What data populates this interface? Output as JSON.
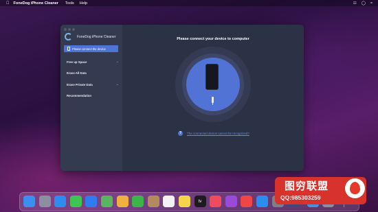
{
  "menubar": {
    "app_name": "FoneDog iPhone Cleaner",
    "items": [
      "Tools",
      "Help"
    ],
    "right_icons": [
      "apple-menu-icon",
      "control-center-icon"
    ]
  },
  "window": {
    "brand": "FoneDog iPhone Cleaner",
    "sidebar": {
      "connect_button": "Please connect the device",
      "items": [
        {
          "label": "Free up Space",
          "has_chevron": true
        },
        {
          "label": "Erase All Data",
          "has_chevron": false
        },
        {
          "label": "Erase Private Data",
          "has_chevron": true
        },
        {
          "label": "Recommendation",
          "has_chevron": false
        }
      ]
    },
    "main": {
      "title": "Please connect your device to computer",
      "help_mark": "?",
      "help_link": "The connected device cannot be recognized?"
    }
  },
  "dock": {
    "icons": [
      {
        "name": "finder-icon",
        "color": "#3b8ff0"
      },
      {
        "name": "launchpad-icon",
        "color": "#8c8fa0"
      },
      {
        "name": "safari-icon",
        "color": "#2d8cf0"
      },
      {
        "name": "messages-icon",
        "color": "#3ec451"
      },
      {
        "name": "mail-icon",
        "color": "#2f7cf0"
      },
      {
        "name": "maps-icon",
        "color": "#5ab460"
      },
      {
        "name": "photos-icon",
        "color": "#f0b040"
      },
      {
        "name": "facetime-icon",
        "color": "#3ab54a"
      },
      {
        "name": "contacts-icon",
        "color": "#b28a5e"
      },
      {
        "name": "reminders-icon",
        "color": "#f2f2f2"
      },
      {
        "name": "notes-icon",
        "color": "#f5d54a"
      },
      {
        "name": "appletv-icon",
        "color": "#1c1c1e",
        "text": "tv"
      },
      {
        "name": "music-icon",
        "color": "#f04a5e"
      },
      {
        "name": "podcasts-icon",
        "color": "#9a4ad8"
      },
      {
        "name": "news-icon",
        "color": "#f04545"
      },
      {
        "name": "appstore-icon",
        "color": "#2d8cf0"
      },
      {
        "name": "system-preferences-icon",
        "color": "#7d7f88"
      },
      {
        "name": "fonedog-icon",
        "color": "#3a4a7a"
      },
      {
        "name": "downloads-folder-icon",
        "color": "#4a90d8"
      },
      {
        "name": "trash-icon",
        "color": "#8c8f98"
      }
    ]
  },
  "watermark": {
    "title": "图穷联盟",
    "qq": "QQ:985303259"
  }
}
